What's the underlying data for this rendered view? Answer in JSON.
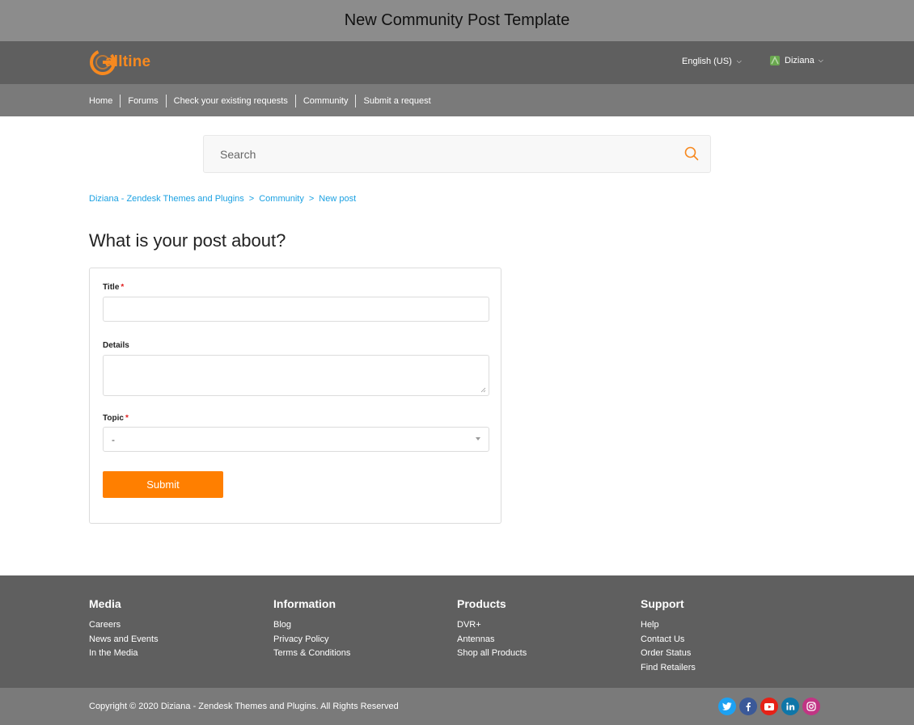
{
  "window": {
    "title": "New Community Post Template"
  },
  "header": {
    "logo_text": "alltine",
    "language": "English (US)",
    "user_name": "Diziana"
  },
  "nav": {
    "items": [
      {
        "label": "Home"
      },
      {
        "label": "Forums"
      },
      {
        "label": "Check your existing requests"
      },
      {
        "label": "Community"
      },
      {
        "label": "Submit a request"
      }
    ]
  },
  "search": {
    "placeholder": "Search"
  },
  "breadcrumb": [
    {
      "label": "Diziana - Zendesk Themes and Plugins"
    },
    {
      "label": "Community"
    },
    {
      "label": "New post"
    }
  ],
  "breadcrumb_separator": ">",
  "page_title": "What is your post about?",
  "form": {
    "title_label": "Title",
    "details_label": "Details",
    "topic_label": "Topic",
    "required_mark": "*",
    "topic_value": "-",
    "submit_label": "Submit"
  },
  "footer": {
    "columns": [
      {
        "heading": "Media",
        "links": [
          "Careers",
          "News and Events",
          "In the Media"
        ]
      },
      {
        "heading": "Information",
        "links": [
          "Blog",
          "Privacy Policy",
          "Terms & Conditions"
        ]
      },
      {
        "heading": "Products",
        "links": [
          "DVR+",
          "Antennas",
          "Shop all Products"
        ]
      },
      {
        "heading": "Support",
        "links": [
          "Help",
          "Contact Us",
          "Order Status",
          "Find Retailers"
        ]
      }
    ],
    "copyright": "Copyright © 2020 Diziana - Zendesk Themes and Plugins. All Rights Reserved",
    "socials": [
      {
        "icon": "twitter-icon",
        "color": "#1da1f2"
      },
      {
        "icon": "facebook-icon",
        "color": "#3b5998"
      },
      {
        "icon": "youtube-icon",
        "color": "#e62117"
      },
      {
        "icon": "linkedin-icon",
        "color": "#0e76a8"
      },
      {
        "icon": "instagram-icon",
        "color": "#c13584"
      }
    ]
  },
  "colors": {
    "accent": "#ff7f00",
    "link": "#1ba1e2",
    "header_bg": "#5f5f5f",
    "nav_bg": "#7a7a7a"
  }
}
